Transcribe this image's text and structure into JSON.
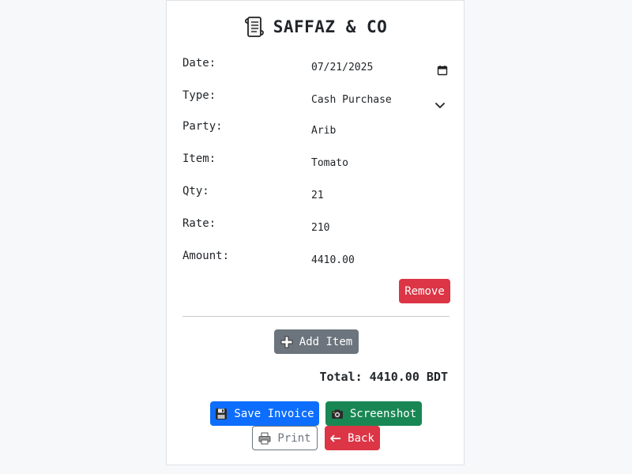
{
  "header": {
    "title": "SAFFAZ & CO",
    "icon": "scroll-icon"
  },
  "form": {
    "date": {
      "label": "Date:",
      "value": "07/21/2025",
      "icon": "calendar-icon"
    },
    "type": {
      "label": "Type:",
      "value": "Cash Purchase",
      "icon": "chevron-down-icon"
    },
    "party": {
      "label": "Party:",
      "value": "Arib"
    },
    "item": {
      "label": "Item:",
      "value": "Tomato"
    },
    "qty": {
      "label": "Qty:",
      "value": "21"
    },
    "rate": {
      "label": "Rate:",
      "value": "210"
    },
    "amount": {
      "label": "Amount:",
      "value": "4410.00"
    }
  },
  "buttons": {
    "remove": "Remove",
    "add_item": "Add Item",
    "save_invoice": "Save Invoice",
    "screenshot": "Screenshot",
    "print": "Print",
    "back": "Back"
  },
  "total": "Total: 4410.00 BDT",
  "colors": {
    "danger": "#dc3545",
    "secondary": "#6c757d",
    "primary": "#0d6efd",
    "success": "#198754"
  }
}
